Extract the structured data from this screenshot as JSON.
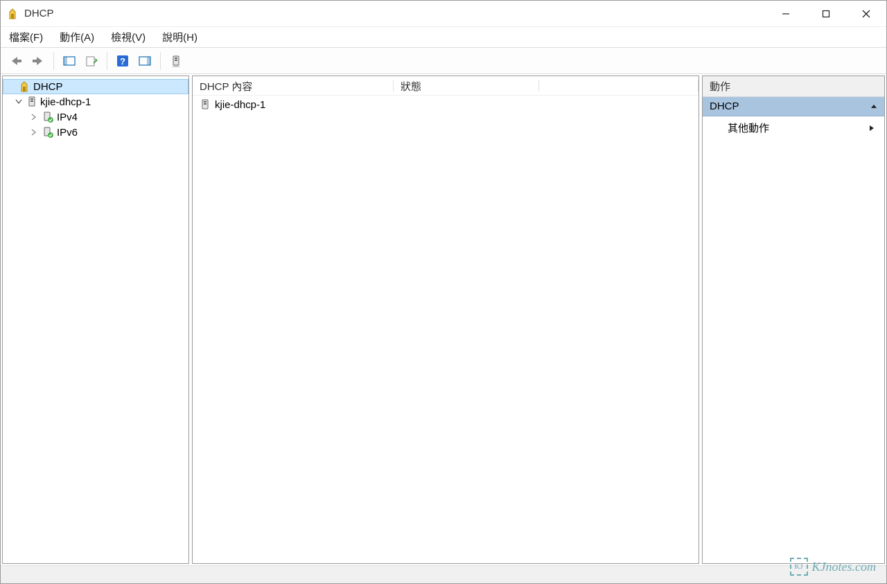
{
  "title": "DHCP",
  "menu": {
    "file": "檔案(F)",
    "action": "動作(A)",
    "view": "檢視(V)",
    "help": "說明(H)"
  },
  "tree": {
    "root": "DHCP",
    "server": "kjie-dhcp-1",
    "items": [
      {
        "label": "IPv4"
      },
      {
        "label": "IPv6"
      }
    ]
  },
  "main": {
    "columns": {
      "name": "DHCP 內容",
      "status": "狀態"
    },
    "rows": [
      {
        "name": "kjie-dhcp-1"
      }
    ]
  },
  "actions": {
    "header": "動作",
    "title": "DHCP",
    "items": [
      {
        "label": "其他動作"
      }
    ]
  },
  "watermark": {
    "badge": "KJ",
    "text": "KJnotes.com"
  }
}
